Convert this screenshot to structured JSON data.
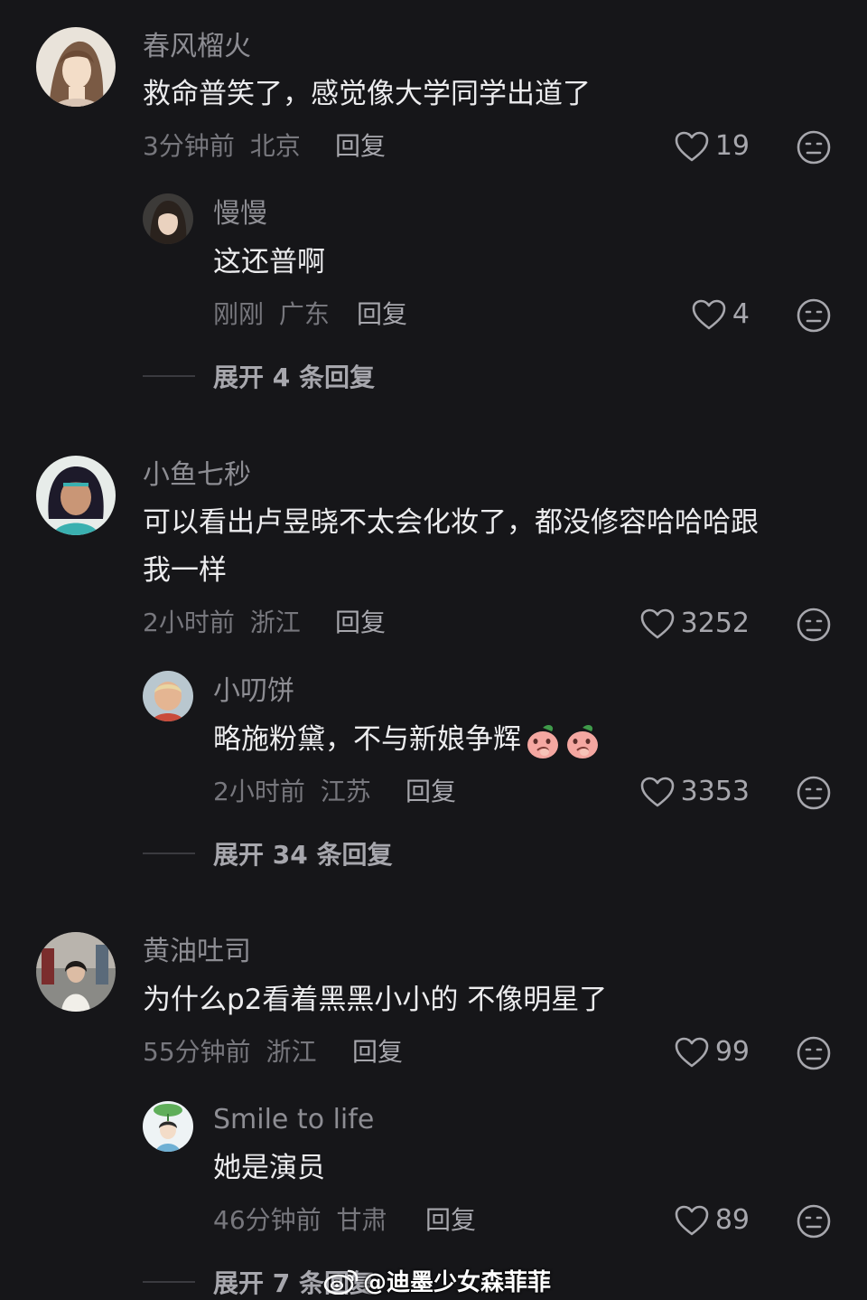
{
  "threads": [
    {
      "comment": {
        "username": "春风榴火",
        "text": "救命普笑了，感觉像大学同学出道了",
        "time": "3分钟前",
        "location": "北京",
        "reply_label": "回复",
        "likes": "19"
      },
      "reply": {
        "username": "慢慢",
        "text": "这还普啊",
        "time": "刚刚",
        "location": "广东",
        "reply_label": "回复",
        "likes": "4"
      },
      "expand_label": "展开 4 条回复"
    },
    {
      "comment": {
        "username": "小鱼七秒",
        "text_line1": "可以看出卢昱晓不太会化妆了，都没修容哈哈哈跟",
        "text_line2": "我一样",
        "time": "2小时前",
        "location": "浙江",
        "reply_label": "回复",
        "likes": "3252"
      },
      "reply": {
        "username": "小叨饼",
        "text": "略施粉黛，不与新娘争辉",
        "emoji": "peach-emoji",
        "time": "2小时前",
        "location": "江苏",
        "reply_label": "回复",
        "likes": "3353"
      },
      "expand_label": "展开 34 条回复"
    },
    {
      "comment": {
        "username": "黄油吐司",
        "text": "为什么p2看着黑黑小小的 不像明星了",
        "time": "55分钟前",
        "location": "浙江",
        "reply_label": "回复",
        "likes": "99"
      },
      "reply": {
        "username": "Smile to life",
        "text": "她是演员",
        "time": "46分钟前",
        "location": "甘肃",
        "reply_label": "回复",
        "likes": "89"
      },
      "expand_label": "展开 7 条回复"
    }
  ],
  "watermark": {
    "text": "@迪墨少女森菲菲",
    "icon": "weibo-icon"
  },
  "colors": {
    "background": "#161619",
    "text": "#ececee",
    "muted": "#77777d",
    "username": "#8d8d93"
  }
}
